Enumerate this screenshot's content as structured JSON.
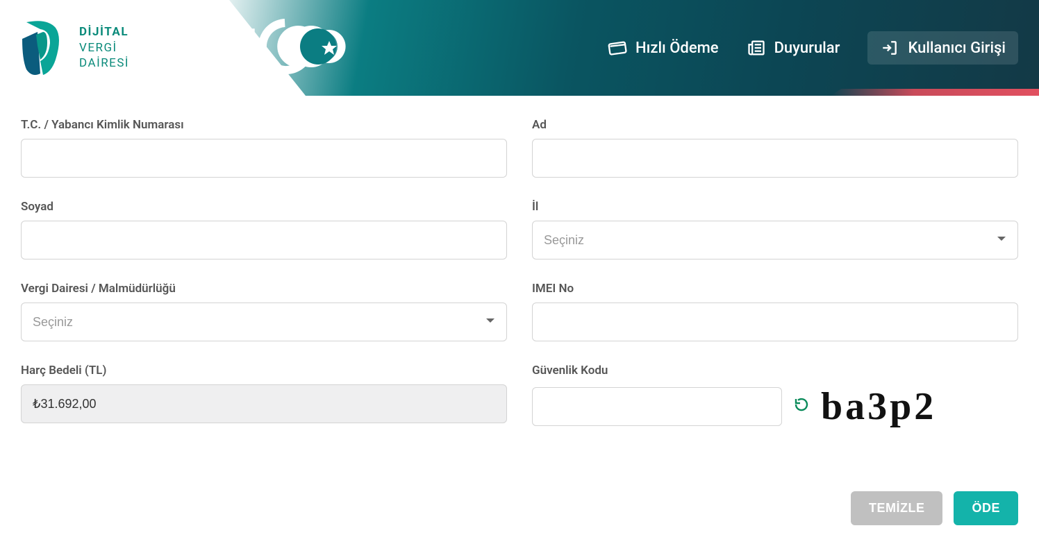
{
  "header": {
    "logo": {
      "line1": "DİJİTAL",
      "line2": "VERGİ",
      "line3": "DAİRESİ"
    },
    "nav": {
      "quick_pay": "Hızlı Ödeme",
      "announcements": "Duyurular",
      "login": "Kullanıcı Girişi"
    }
  },
  "form": {
    "tc_label": "T.C. / Yabancı Kimlik Numarası",
    "ad_label": "Ad",
    "soyad_label": "Soyad",
    "il_label": "İl",
    "il_placeholder": "Seçiniz",
    "vd_label": "Vergi Dairesi / Malmüdürlüğü",
    "vd_placeholder": "Seçiniz",
    "imei_label": "IMEI No",
    "harc_label": "Harç Bedeli (TL)",
    "harc_value": "₺31.692,00",
    "guvenlik_label": "Güvenlik Kodu",
    "captcha_text": "ba3p2"
  },
  "actions": {
    "clear": "TEMİZLE",
    "pay": "ÖDE"
  }
}
